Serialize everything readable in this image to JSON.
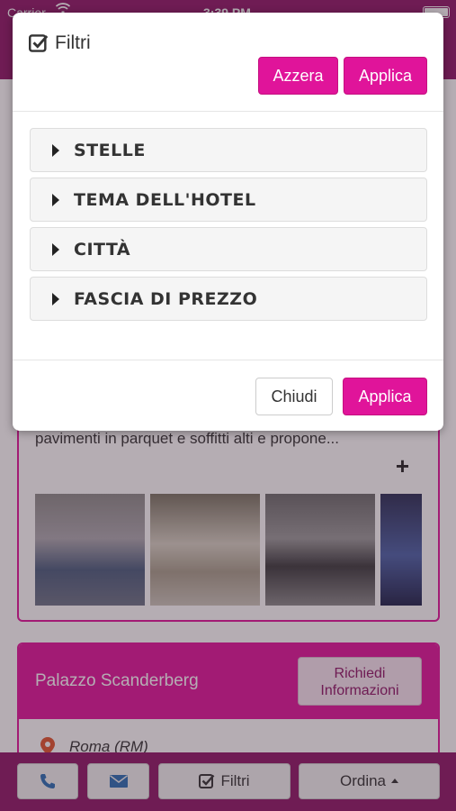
{
  "status_bar": {
    "carrier": "Carrier",
    "time": "3:39 PM"
  },
  "background": {
    "hotel_card": {
      "description": "pavimenti in parquet e soffitti alti e propone...",
      "expand_symbol": "+"
    },
    "second_card": {
      "hotel_name": "Palazzo Scanderberg",
      "info_button": "Richiedi Informazioni",
      "location": "Roma (RM)"
    },
    "bottom_bar": {
      "filter_label": "Filtri",
      "sort_label": "Ordina"
    }
  },
  "modal": {
    "title": "Filtri",
    "reset_label": "Azzera",
    "apply_label": "Applica",
    "filters": [
      {
        "label": "STELLE"
      },
      {
        "label": "TEMA DELL'HOTEL"
      },
      {
        "label": "CITTÀ"
      },
      {
        "label": "FASCIA DI PREZZO"
      }
    ],
    "close_label": "Chiudi",
    "apply_bottom_label": "Applica"
  },
  "colors": {
    "accent": "#e0149a",
    "brand_dark": "#8e1566"
  }
}
